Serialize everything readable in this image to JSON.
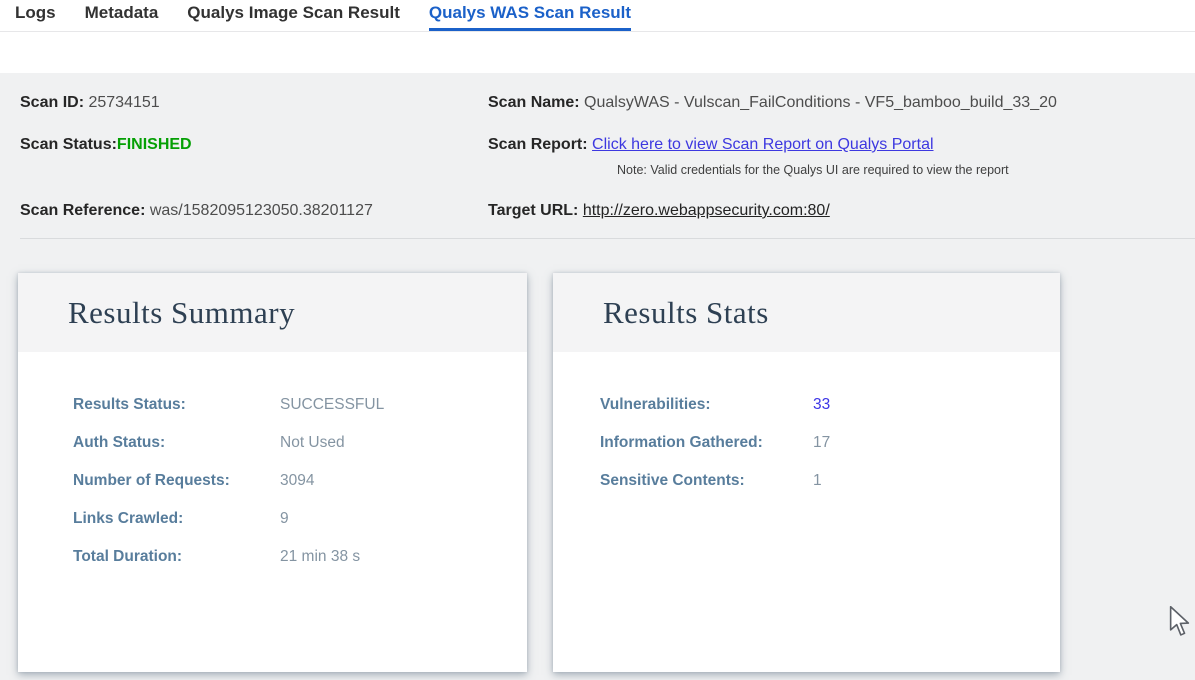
{
  "tabs": [
    {
      "label": "Logs",
      "active": false
    },
    {
      "label": "Metadata",
      "active": false
    },
    {
      "label": "Qualys Image Scan Result",
      "active": false
    },
    {
      "label": "Qualys WAS Scan Result",
      "active": true
    }
  ],
  "scan_info": {
    "scan_id_label": "Scan ID:",
    "scan_id": "25734151",
    "scan_status_label": "Scan Status:",
    "scan_status": "FINISHED",
    "scan_reference_label": "Scan Reference:",
    "scan_reference": "was/1582095123050.38201127",
    "scan_name_label": "Scan Name:",
    "scan_name": "QualsyWAS - Vulscan_FailConditions - VF5_bamboo_build_33_20",
    "scan_report_label": "Scan Report:",
    "scan_report_link": "Click here to view Scan Report on Qualys Portal",
    "scan_report_note": "Note: Valid credentials for the Qualys UI are required to view the report",
    "target_url_label": "Target URL:",
    "target_url": "http://zero.webappsecurity.com:80/"
  },
  "results_summary": {
    "title": "Results Summary",
    "rows": [
      {
        "label": "Results Status:",
        "value": "SUCCESSFUL"
      },
      {
        "label": "Auth Status:",
        "value": "Not Used"
      },
      {
        "label": "Number of Requests:",
        "value": "3094"
      },
      {
        "label": "Links Crawled:",
        "value": "9"
      },
      {
        "label": "Total Duration:",
        "value": "21 min 38 s"
      }
    ]
  },
  "results_stats": {
    "title": "Results Stats",
    "rows": [
      {
        "label": "Vulnerabilities:",
        "value": "33"
      },
      {
        "label": "Information Gathered:",
        "value": "17"
      },
      {
        "label": "Sensitive Contents:",
        "value": "1"
      }
    ]
  },
  "colors": {
    "active_tab_blue": "#1b61c9",
    "status_green": "#05a005",
    "report_link_blue": "#3d38e0",
    "card_label_blue": "#587d9c",
    "vulnerabilities_link_blue": "#3c35e6",
    "panel_gray": "#f0f1f2"
  }
}
